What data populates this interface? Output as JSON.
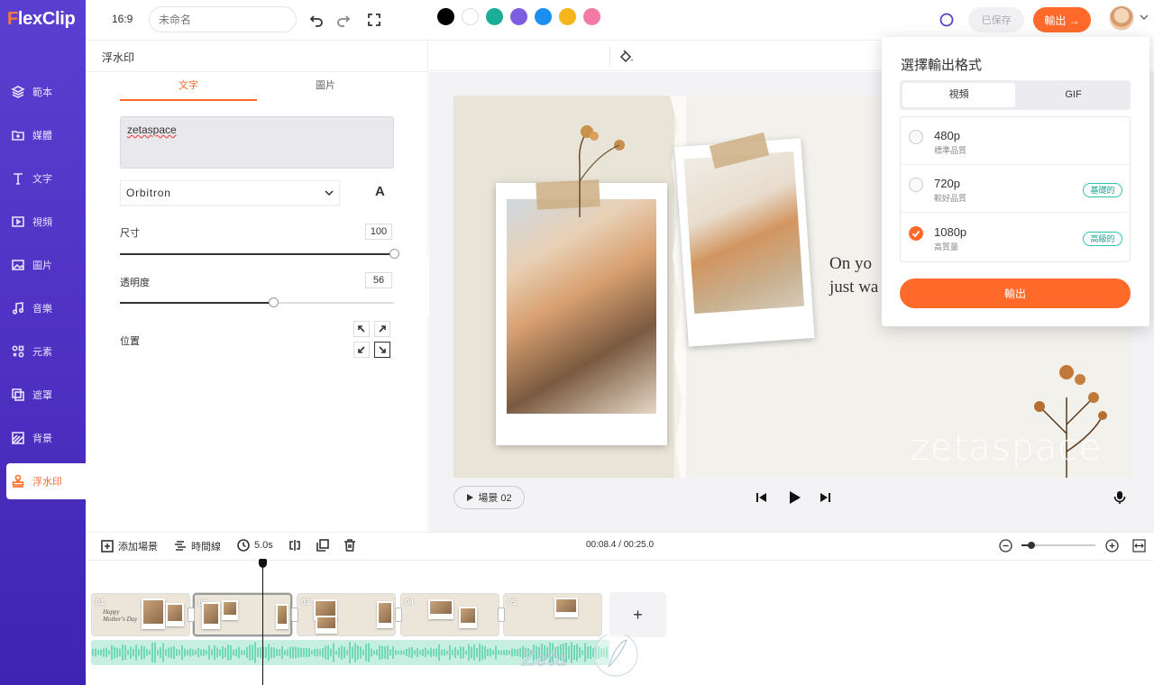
{
  "app": {
    "logo": {
      "first": "F",
      "rest": "lexClip"
    },
    "aspect_ratio": "16:9",
    "project_name_placeholder": "未命名",
    "saved_label": "已保存",
    "export_label": "輸出 →",
    "accent_color": "#ff6a2b",
    "sidebar_color": "#4c2fc0"
  },
  "sidebar": {
    "items": [
      {
        "label": "範本",
        "icon": "layers-icon"
      },
      {
        "label": "媒體",
        "icon": "media-add-icon"
      },
      {
        "label": "文字",
        "icon": "text-icon"
      },
      {
        "label": "視頻",
        "icon": "video-icon"
      },
      {
        "label": "圖片",
        "icon": "image-icon"
      },
      {
        "label": "音樂",
        "icon": "music-icon"
      },
      {
        "label": "元素",
        "icon": "elements-icon"
      },
      {
        "label": "遮罩",
        "icon": "overlay-icon"
      },
      {
        "label": "背景",
        "icon": "background-icon"
      },
      {
        "label": "浮水印",
        "icon": "stamp-icon"
      }
    ],
    "active_index": 9
  },
  "panel": {
    "title": "浮水印",
    "tabs": [
      "文字",
      "圖片"
    ],
    "active_tab": 0,
    "watermark_text": "zetaspace",
    "font": "Orbitron",
    "font_style_label": "A",
    "size_label": "尺寸",
    "size_value": "100",
    "size_fraction": 1.0,
    "opacity_label": "透明度",
    "opacity_value": "56",
    "opacity_fraction": 0.56,
    "position_label": "位置",
    "position_active": "bottom-right"
  },
  "color_bar": {
    "swatches": [
      "#000000",
      "#ffffff",
      "#1aae96",
      "#7d5ee0",
      "#1b8ff0",
      "#f6b51b",
      "#f37aa6"
    ]
  },
  "canvas": {
    "text_line1": "On yo",
    "text_line2": "just wa",
    "watermark": "zetaspace",
    "scene_label": "場景 02"
  },
  "export_panel": {
    "title": "選擇輸出格式",
    "formats": [
      "視頻",
      "GIF"
    ],
    "active_format": 0,
    "resolutions": [
      {
        "name": "480p",
        "sub": "標準品質",
        "badge": "",
        "checked": false
      },
      {
        "name": "720p",
        "sub": "較好品質",
        "badge": "基礎的",
        "checked": false
      },
      {
        "name": "1080p",
        "sub": "高質量",
        "badge": "高級的",
        "checked": true
      }
    ],
    "submit_label": "輸出"
  },
  "timeline": {
    "add_scene_label": "添加場景",
    "timeline_label": "時間線",
    "duration_label": "5.0s",
    "timecode": "00:08.4 / 00:25.0",
    "clips": [
      {
        "num": "01",
        "caption": "Happy Mother's Day"
      },
      {
        "num": "02",
        "caption": ""
      },
      {
        "num": "03",
        "caption": ""
      },
      {
        "num": "04",
        "caption": ""
      },
      {
        "num": "05",
        "caption": ""
      }
    ],
    "selected_clip": 1,
    "add_clip_label": "+"
  }
}
